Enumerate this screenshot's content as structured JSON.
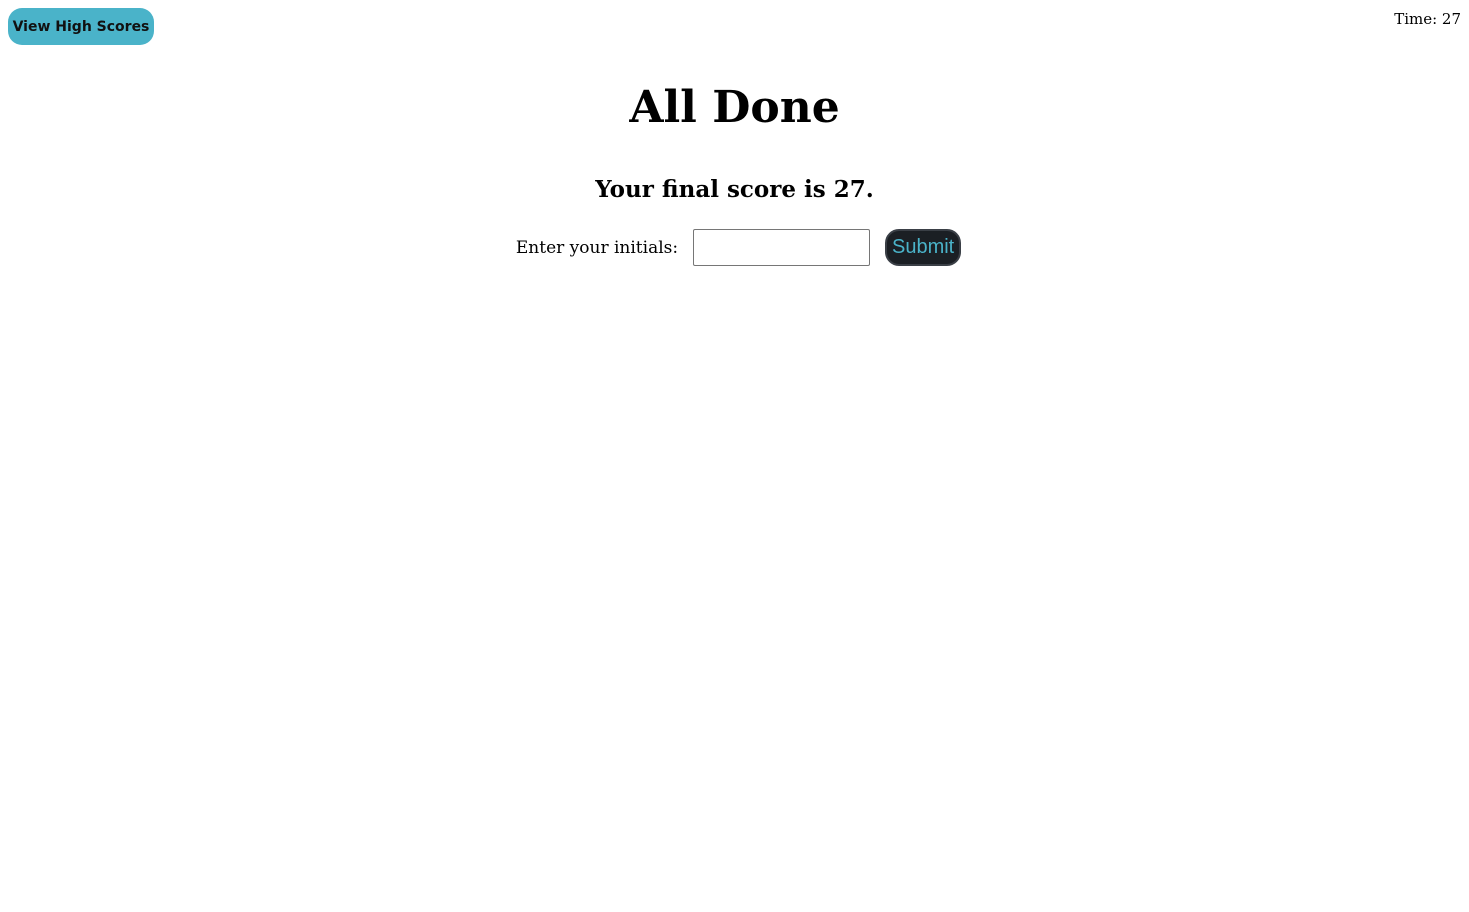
{
  "header": {
    "high_scores_label": "View High Scores",
    "timer_text": "Time: 27"
  },
  "main": {
    "title": "All Done",
    "score_text": "Your final score is 27.",
    "initials_label": "Enter your initials:",
    "initials_value": "",
    "initials_placeholder": "",
    "submit_label": "Submit"
  },
  "colors": {
    "accent": "#4ab3c9",
    "submit_background": "#1b1f24",
    "text": "#000000",
    "background": "#ffffff"
  }
}
